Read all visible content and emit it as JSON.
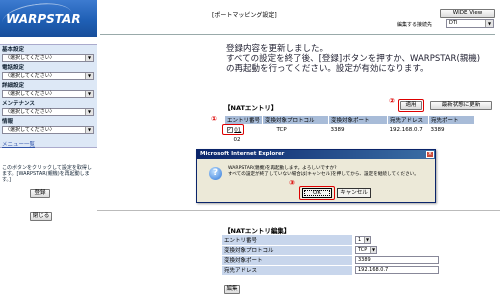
{
  "sidebar": {
    "logo": "WARPSTAR",
    "groups": [
      {
        "label": "基本設定",
        "select": "〈選択してください〉"
      },
      {
        "label": "電話設定",
        "select": "〈選択してください〉"
      },
      {
        "label": "詳細設定",
        "select": "〈選択してください〉"
      },
      {
        "label": "メンテナンス",
        "select": "〈選択してください〉"
      },
      {
        "label": "情報",
        "select": "〈選択してください〉"
      }
    ],
    "menu_link": "メニュー一覧",
    "note": "このボタンをクリックして設定を取得します。[WARPSTAR(親機)を再起動します。]",
    "register_button": "登録",
    "close_button": "閉じる"
  },
  "header": {
    "title": "[ポートマッピング設定]",
    "wide_view_button": "WIDE View",
    "scope_label": "編集する接続先",
    "scope_value": "DTI"
  },
  "notice": {
    "line1": "登録内容を更新しました。",
    "line2": "すべての設定を終了後、[登録]ボタンを押すか、WARPSTAR(親機)",
    "line3": "の再起動を行ってください。設定が有効になります。"
  },
  "nat_entry": {
    "title": "【NATエントリ】",
    "apply_button": "適用",
    "refresh_button": "最新状態に更新",
    "columns": [
      "エントリ番号",
      "変換対象プロトコル",
      "変換対象ポート",
      "宛先アドレス",
      "宛先ポート"
    ],
    "rows": [
      {
        "no": "01",
        "protocol": "TCP",
        "port": "3389",
        "dest": "192.168.0.7",
        "dest_port": "3389",
        "checked": true
      },
      {
        "no": "02",
        "protocol": "",
        "port": "",
        "dest": "",
        "dest_port": "",
        "checked": false
      }
    ]
  },
  "markers": {
    "one": "①",
    "two": "②",
    "three": "③"
  },
  "dialog": {
    "title": "Microsoft Internet Explorer",
    "close": "×",
    "icon": "?",
    "message1": "WARPSTAR(親機)を再起動します。よろしいですか?",
    "message2": "すべての設定が終了していない場合は[キャンセル]を押してから、設定を継続してください。",
    "ok_button": "OK",
    "cancel_button": "キャンセル"
  },
  "nat_edit": {
    "title": "【NATエントリ編集】",
    "fields": [
      {
        "label": "エントリ番号",
        "value": "1"
      },
      {
        "label": "変換対象プロトコル",
        "value": "TCP"
      },
      {
        "label": "変換対象ポート",
        "value": "3389"
      },
      {
        "label": "宛先アドレス",
        "value": "192.168.0.7"
      }
    ],
    "edit_button": "編集"
  },
  "colors": {
    "accent_red": "#dd0000",
    "header_blue": "#a8bcd8",
    "dialog_title": "#0a246a"
  }
}
